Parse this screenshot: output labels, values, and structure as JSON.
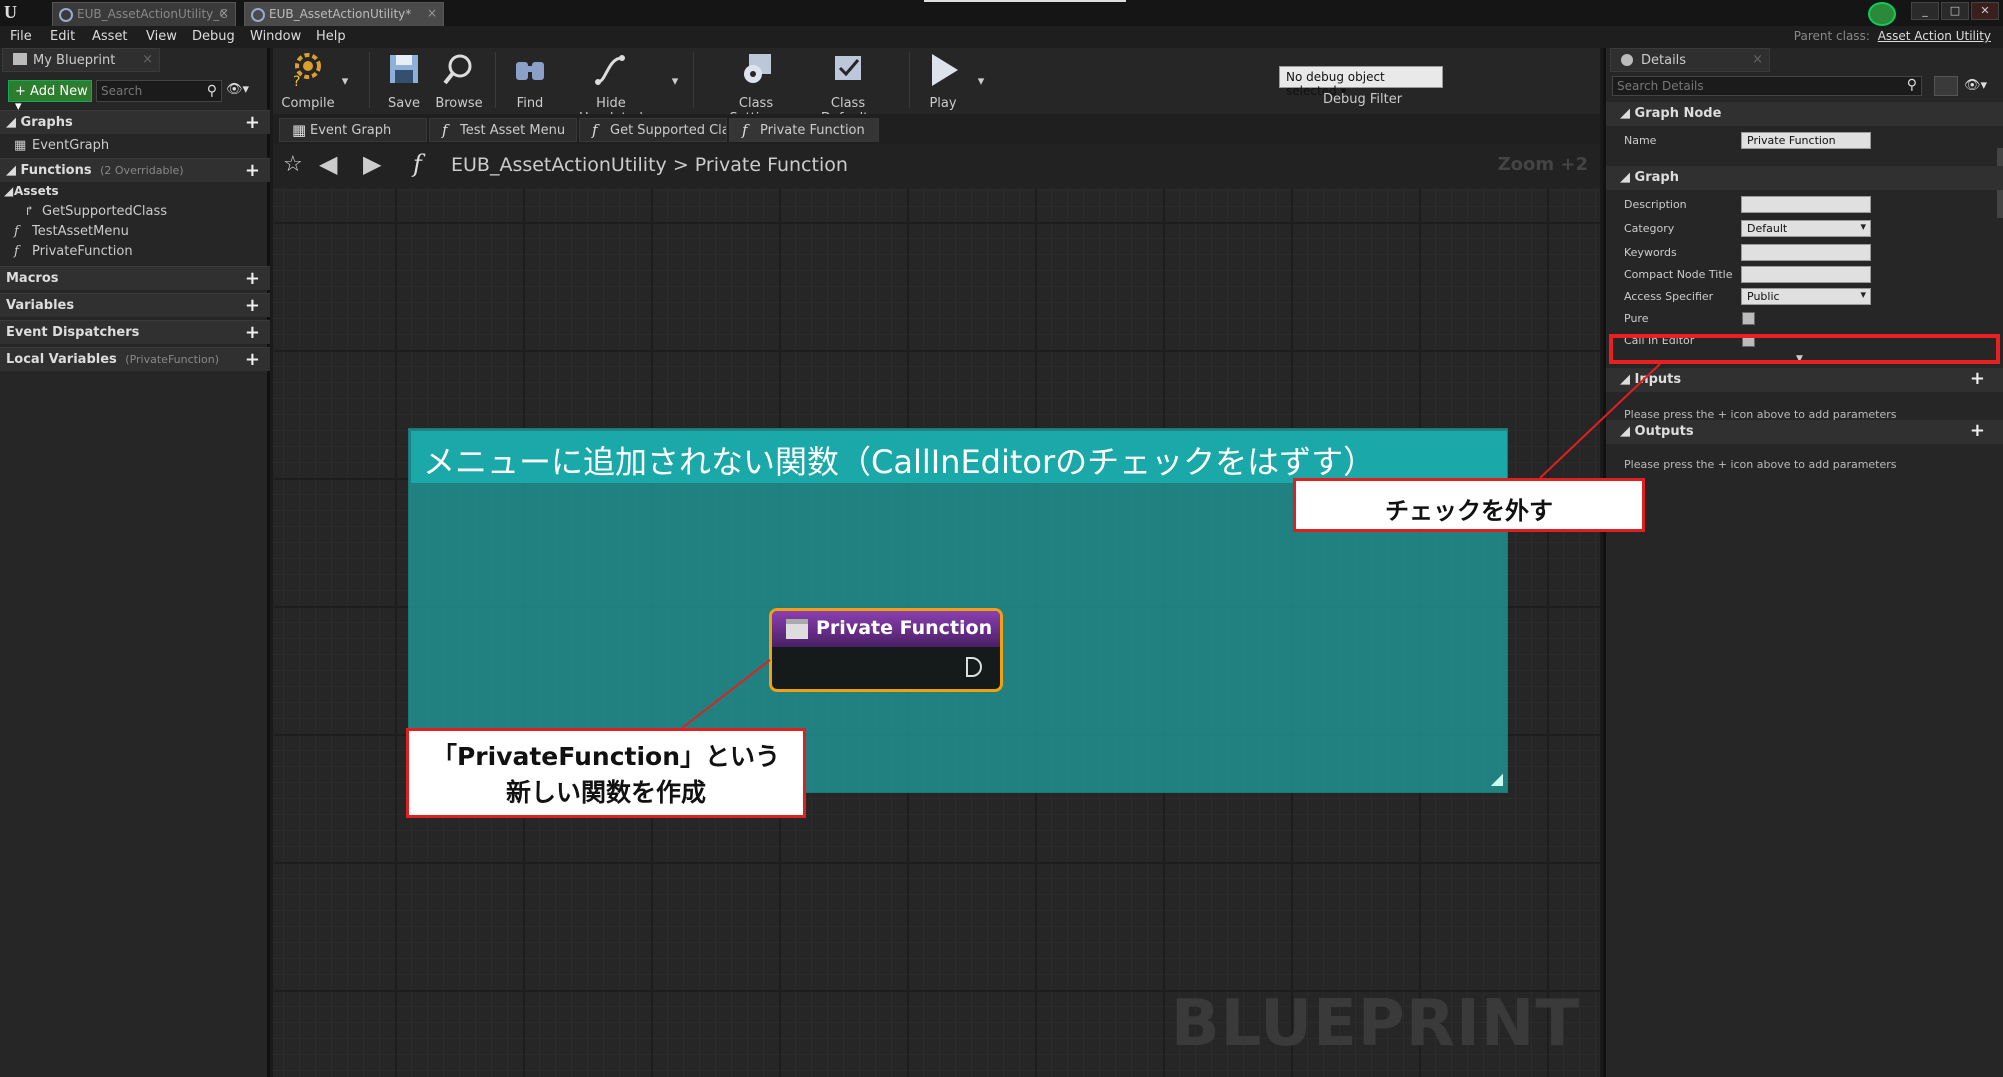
{
  "window": {
    "doc_tabs": [
      "EUB_AssetActionUtility_C",
      "EUB_AssetActionUtility*"
    ],
    "buttons": [
      "_",
      "□",
      "✕"
    ]
  },
  "menu": {
    "items": [
      "File",
      "Edit",
      "Asset",
      "View",
      "Debug",
      "Window",
      "Help"
    ],
    "parent_class_label": "Parent class:",
    "parent_class_value": "Asset Action Utility"
  },
  "my_blueprint": {
    "tab_label": "My Blueprint",
    "add_new_label": "Add New",
    "search_placeholder": "Search",
    "sections": {
      "graphs": "Graphs",
      "functions": "Functions",
      "functions_sub": "(2 Overridable)",
      "assets": "Assets",
      "macros": "Macros",
      "variables": "Variables",
      "event_dispatchers": "Event Dispatchers",
      "local_variables": "Local Variables",
      "local_variables_sub": "(PrivateFunction)"
    },
    "graph_items": [
      "EventGraph"
    ],
    "function_items": [
      "GetSupportedClass",
      "TestAssetMenu",
      "PrivateFunction"
    ]
  },
  "toolbar": {
    "compile": "Compile",
    "save": "Save",
    "browse": "Browse",
    "find": "Find",
    "hide_unrelated": "Hide Unrelated",
    "class_settings": "Class Settings",
    "class_defaults": "Class Defaults",
    "play": "Play",
    "debug_select": "No debug object selected",
    "debug_filter": "Debug Filter"
  },
  "graph_tabs": [
    "Event Graph",
    "Test Asset Menu",
    "Get Supported Clas",
    "Private Function"
  ],
  "breadcrumb": {
    "asset": "EUB_AssetActionUtility",
    "sep": ">",
    "function": "Private Function",
    "zoom": "Zoom +2"
  },
  "graph": {
    "comment_title": "メニューに追加されない関数（CallInEditorのチェックをはずす）",
    "node_title": "Private Function",
    "watermark": "BLUEPRINT"
  },
  "callouts": {
    "left_line1": "「PrivateFunction」という",
    "left_line2": "新しい関数を作成",
    "right": "チェックを外す"
  },
  "details": {
    "tab_label": "Details",
    "search_placeholder": "Search Details",
    "graph_node_cat": "Graph Node",
    "name_label": "Name",
    "name_value": "Private Function",
    "graph_cat": "Graph",
    "description_label": "Description",
    "category_label": "Category",
    "category_value": "Default",
    "keywords_label": "Keywords",
    "compact_label": "Compact Node Title",
    "access_label": "Access Specifier",
    "access_value": "Public",
    "pure_label": "Pure",
    "call_in_editor_label": "Call In Editor",
    "inputs_cat": "Inputs",
    "outputs_cat": "Outputs",
    "inputs_note": "Please press the + icon above to add parameters",
    "outputs_note": "Please press the + icon above to add parameters"
  },
  "colors": {
    "accent_red": "#e02020",
    "comment_teal": "#1aa8a8",
    "node_border": "#f0a010",
    "add_new_green": "#2e7d2e"
  }
}
